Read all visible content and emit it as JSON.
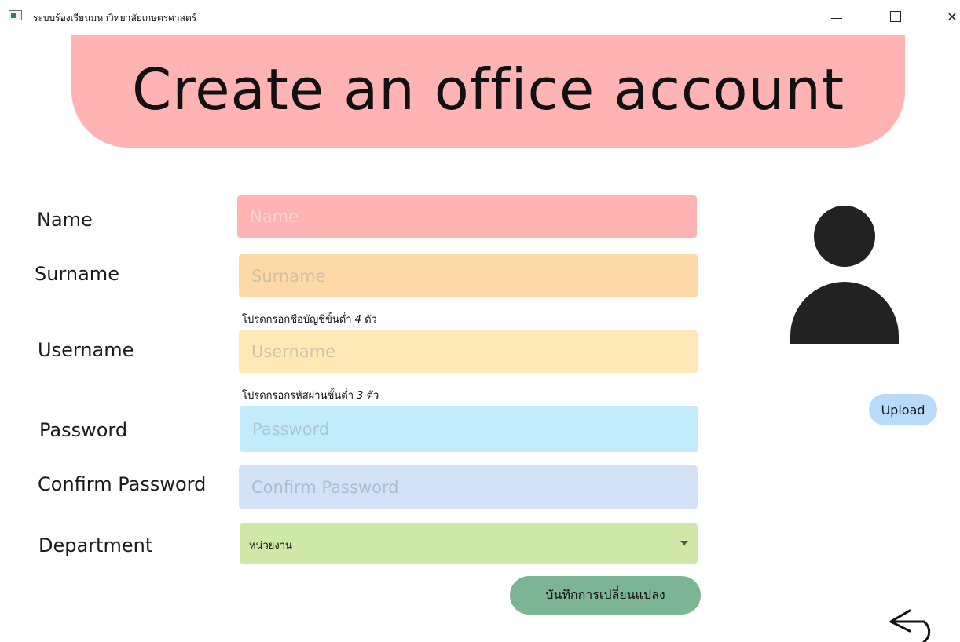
{
  "window": {
    "title": "ระบบร้องเรียนมหาวิทยาลัยเกษตรศาสตร์",
    "minimize_icon": "minimize-icon",
    "maximize_icon": "maximize-icon",
    "close_label": "✕"
  },
  "banner": {
    "title": "Create an office account"
  },
  "form": {
    "name": {
      "label": "Name",
      "placeholder": "Name",
      "color": "#ffb3b3"
    },
    "surname": {
      "label": "Surname",
      "placeholder": "Surname",
      "color": "#fdd9a6"
    },
    "username": {
      "label": "Username",
      "placeholder": "Username",
      "color": "#fde8b6",
      "hint_text": "โปรดกรอกชื่อบัญชีขั้นต่ำ",
      "hint_number": "4",
      "hint_unit": "ตัว"
    },
    "password": {
      "label": "Password",
      "placeholder": "Password",
      "color": "#c2ecfb",
      "hint_text": "โปรดกรอกรหัสผ่านขั้นต่ำ",
      "hint_number": "3",
      "hint_unit": "ตัว"
    },
    "confirm_password": {
      "label": "Confirm Password",
      "placeholder": "Confirm Password",
      "color": "#d4e2f7"
    },
    "department": {
      "label": "Department",
      "selected": "หน่วยงาน",
      "color": "#cfe8a8"
    },
    "save_label": "บันทึกการเปลี่ยนแปลง"
  },
  "profile": {
    "avatar_icon": "user-avatar-icon",
    "upload_label": "Upload"
  },
  "nav": {
    "back_icon": "back-arrow-icon"
  }
}
